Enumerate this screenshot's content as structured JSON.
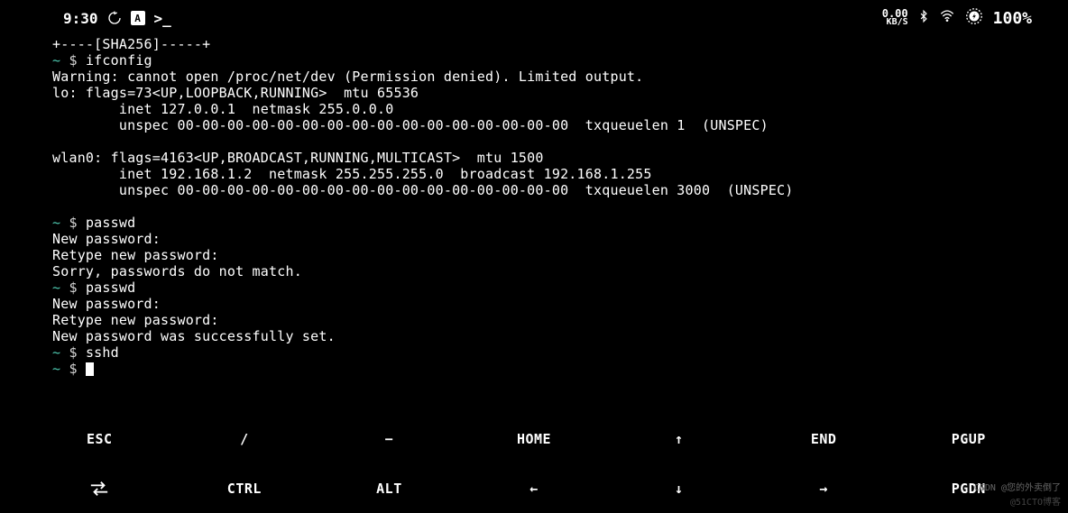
{
  "statusbar": {
    "time": "9:30",
    "net_speed_value": "0.00",
    "net_speed_unit": "KB/S",
    "battery_percent": "100%"
  },
  "terminal": {
    "lines": [
      "+----[SHA256]-----+",
      {
        "prompt": true,
        "cmd": "ifconfig"
      },
      "Warning: cannot open /proc/net/dev (Permission denied). Limited output.",
      "lo: flags=73<UP,LOOPBACK,RUNNING>  mtu 65536",
      "        inet 127.0.0.1  netmask 255.0.0.0",
      "        unspec 00-00-00-00-00-00-00-00-00-00-00-00-00-00-00-00  txqueuelen 1  (UNSPEC)",
      "",
      "wlan0: flags=4163<UP,BROADCAST,RUNNING,MULTICAST>  mtu 1500",
      "        inet 192.168.1.2  netmask 255.255.255.0  broadcast 192.168.1.255",
      "        unspec 00-00-00-00-00-00-00-00-00-00-00-00-00-00-00-00  txqueuelen 3000  (UNSPEC)",
      "",
      {
        "prompt": true,
        "cmd": "passwd"
      },
      "New password:",
      "Retype new password:",
      "Sorry, passwords do not match.",
      {
        "prompt": true,
        "cmd": "passwd"
      },
      "New password:",
      "Retype new password:",
      "New password was successfully set.",
      {
        "prompt": true,
        "cmd": "sshd"
      },
      {
        "prompt": true,
        "cmd": "",
        "cursor": true
      }
    ],
    "prompt_tilde": "~",
    "prompt_dollar": "$"
  },
  "keys": {
    "row1": [
      "ESC",
      "/",
      "−",
      "HOME",
      "↑",
      "END",
      "PGUP"
    ],
    "row2_labels": [
      "TAB_ICON",
      "CTRL",
      "ALT",
      "←",
      "↓",
      "→",
      "PGDN"
    ]
  },
  "watermarks": {
    "w1": "CSDN @您的外卖倒了",
    "w2": "@51CTO博客"
  }
}
